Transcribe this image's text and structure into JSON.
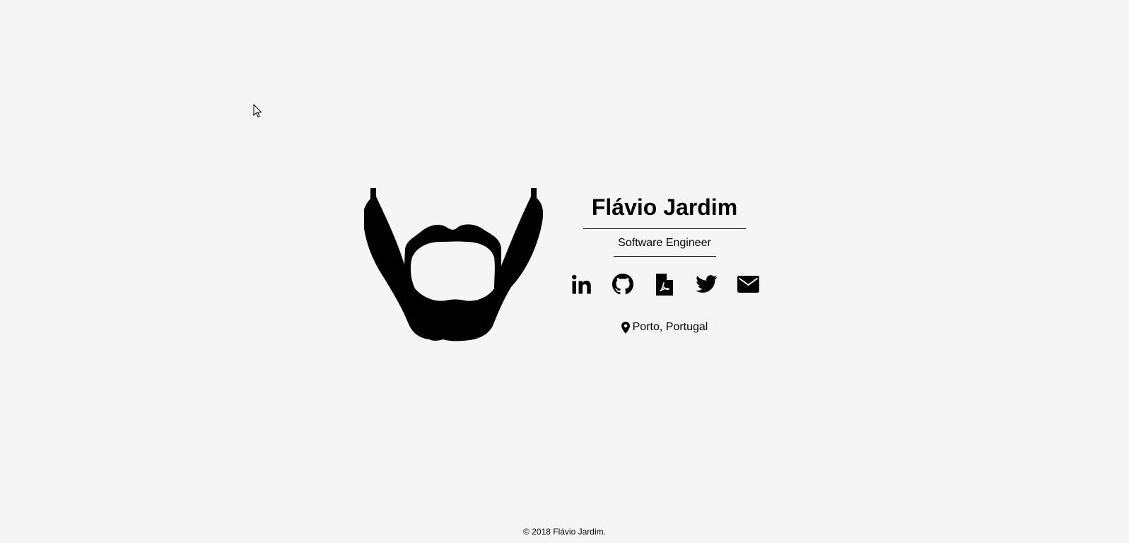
{
  "profile": {
    "name": "Flávio Jardim",
    "role": "Software Engineer",
    "location": "Porto, Portugal"
  },
  "social": [
    {
      "icon": "linkedin-icon"
    },
    {
      "icon": "github-icon"
    },
    {
      "icon": "pdf-file-icon"
    },
    {
      "icon": "twitter-icon"
    },
    {
      "icon": "envelope-icon"
    }
  ],
  "footer": {
    "copyright_symbol": "©",
    "text": "2018 Flávio Jardim."
  }
}
